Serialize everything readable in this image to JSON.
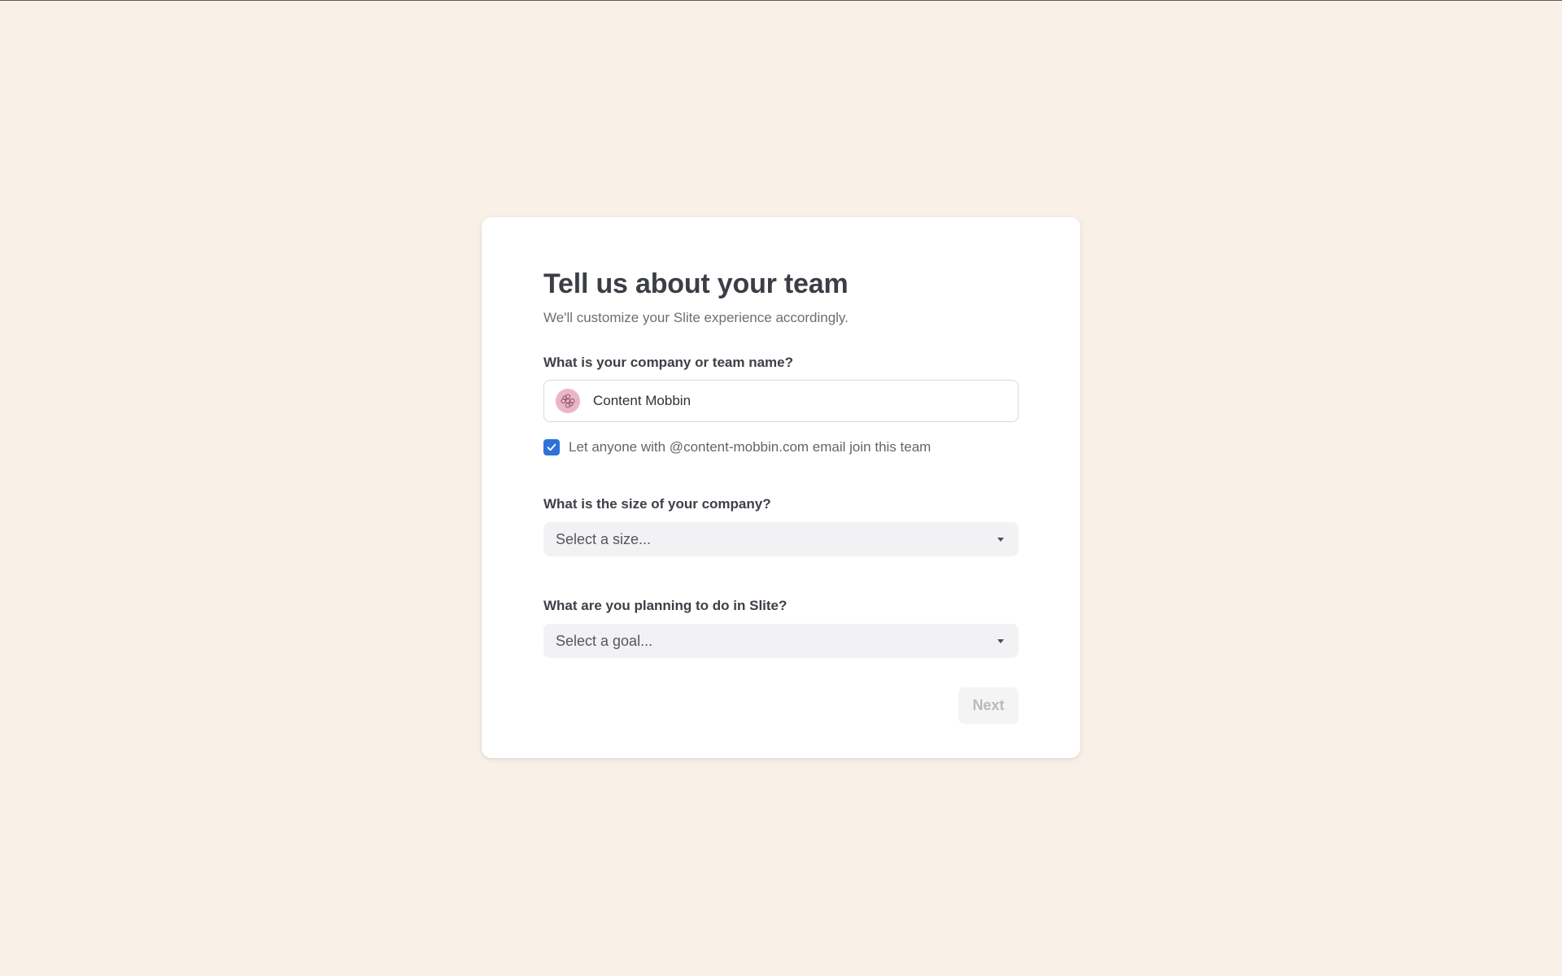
{
  "onboarding": {
    "title": "Tell us about your team",
    "subtitle": "We'll customize your Slite experience accordingly."
  },
  "team_name": {
    "label": "What is your company or team name?",
    "value": "Content Mobbin",
    "avatar_icon": "gear-flower-icon",
    "avatar_color": "#eab6c7"
  },
  "domain_join": {
    "checked": true,
    "label": "Let anyone with @content-mobbin.com email join this team",
    "checkbox_color": "#2d72d9"
  },
  "company_size": {
    "label": "What is the size of your company?",
    "placeholder": "Select a size..."
  },
  "goal": {
    "label": "What are you planning to do in Slite?",
    "placeholder": "Select a goal..."
  },
  "actions": {
    "next_label": "Next",
    "next_disabled": true
  },
  "colors": {
    "page_background": "#f9f0e7",
    "card_background": "#ffffff"
  }
}
